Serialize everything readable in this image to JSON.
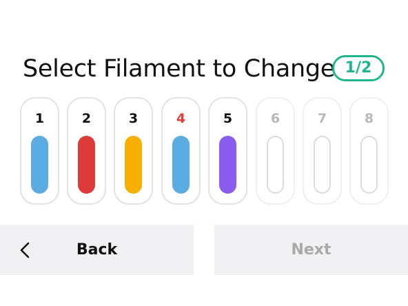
{
  "header": {
    "title": "Select Filament to Change",
    "page_indicator": "1/2",
    "accent_color": "#1fb58a"
  },
  "slots": [
    {
      "label": "1",
      "color": "#5aace3",
      "state": "loaded"
    },
    {
      "label": "2",
      "color": "#df3a3a",
      "state": "loaded"
    },
    {
      "label": "3",
      "color": "#f7b000",
      "state": "loaded"
    },
    {
      "label": "4",
      "color": "#5aace3",
      "state": "selected"
    },
    {
      "label": "5",
      "color": "#8b5cf0",
      "state": "loaded"
    },
    {
      "label": "6",
      "color": "",
      "state": "disabled"
    },
    {
      "label": "7",
      "color": "",
      "state": "disabled"
    },
    {
      "label": "8",
      "color": "",
      "state": "disabled"
    }
  ],
  "footer": {
    "back_label": "Back",
    "back_icon": "chevron-left-icon",
    "next_label": "Next",
    "next_state": "disabled"
  }
}
